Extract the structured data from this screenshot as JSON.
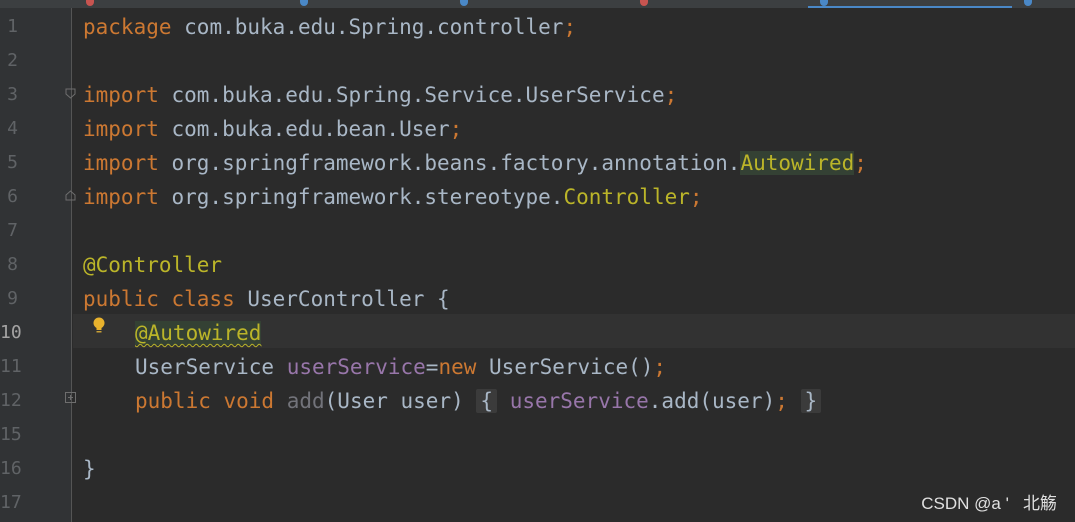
{
  "editor": {
    "lines": [
      {
        "num": "1"
      },
      {
        "num": "2"
      },
      {
        "num": "3"
      },
      {
        "num": "4"
      },
      {
        "num": "5"
      },
      {
        "num": "6"
      },
      {
        "num": "7"
      },
      {
        "num": "8"
      },
      {
        "num": "9"
      },
      {
        "num": "10"
      },
      {
        "num": "11"
      },
      {
        "num": "12"
      },
      {
        "num": "15"
      },
      {
        "num": "16"
      },
      {
        "num": "17"
      }
    ],
    "tokens": {
      "l1_kw": "package",
      "l1_rest": " com.buka.edu.Spring.controller",
      "l1_semi": ";",
      "l3_kw": "import",
      "l3_rest": " com.buka.edu.Spring.Service.UserService",
      "l3_semi": ";",
      "l4_kw": "import",
      "l4_rest": " com.buka.edu.bean.User",
      "l4_semi": ";",
      "l5_kw": "import",
      "l5_rest": " org.springframework.beans.factory.annotation.",
      "l5_hl": "Autowired",
      "l5_semi": ";",
      "l6_kw": "import",
      "l6_rest": " org.springframework.stereotype.",
      "l6_ann": "Controller",
      "l6_semi": ";",
      "l8_ann": "@Controller",
      "l9_kw": "public class",
      "l9_rest": " UserController {",
      "l10_ann": "@Autowired",
      "l11_type": "UserService ",
      "l11_fld": "userService",
      "l11_eq": "=",
      "l11_kw": "new",
      "l11_rest": " UserService()",
      "l11_semi": ";",
      "l12_kw": "public void",
      "l12_method": " add",
      "l12_params": "(User user)",
      "l12_open": "{",
      "l12_fld": "userService",
      "l12_call": ".add(user)",
      "l12_semi": ";",
      "l12_close": "}",
      "l16_close": "}"
    }
  },
  "watermark": "CSDN @a '   北觞",
  "colors": {
    "background": "#2b2b2b",
    "keyword": "#cc7832",
    "annotation": "#bbb529",
    "field": "#9876aa",
    "text": "#a9b7c6"
  }
}
